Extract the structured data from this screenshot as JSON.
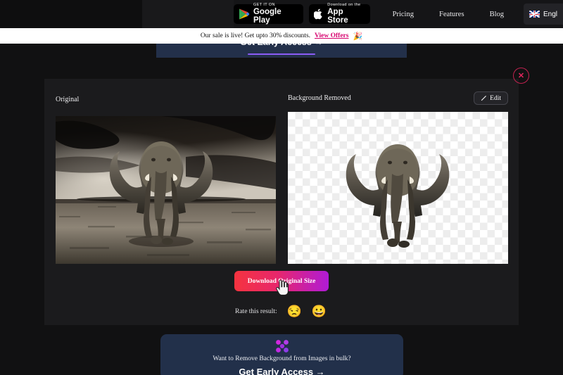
{
  "topnav": {
    "google_play": {
      "small": "GET IT ON",
      "big": "Google Play"
    },
    "app_store": {
      "small": "Download on the",
      "big": "App Store"
    },
    "links": [
      {
        "label": "Pricing"
      },
      {
        "label": "Features"
      },
      {
        "label": "Blog"
      }
    ],
    "language": {
      "label": "Engl",
      "flag": "uk-flag-icon"
    }
  },
  "salebar": {
    "text": "Our sale is live! Get upto 30% discounts.",
    "link": "View Offers",
    "emoji": "🎉"
  },
  "top_promo": {
    "cta": "Get Early Access →"
  },
  "close": {
    "label": "✕"
  },
  "result": {
    "original_label": "Original",
    "removed_label": "Background Removed",
    "edit_label": "Edit",
    "edit_icon": "pencil-icon",
    "original_image_alt": "Black and white photo of an elephant walking on dry plain under stormy sky",
    "removed_image_alt": "Cut-out elephant on transparency checkerboard"
  },
  "download": {
    "label": "Download Original Size"
  },
  "rate": {
    "label": "Rate this result:",
    "negative_emoji": "😒",
    "positive_emoji": "😀"
  },
  "bottom_promo": {
    "question": "Want to Remove Background from Images in bulk?",
    "cta": "Get Early Access →",
    "logo": "x-dots-logo-icon"
  },
  "colors": {
    "page_bg": "#111112",
    "card_bg": "#1b1b1d",
    "accent_gradient_start": "#f5333f",
    "accent_gradient_end": "#b01bd6",
    "promo_bg": "#22304a",
    "close_accent": "#e0255c",
    "offer_link": "#d6006e"
  }
}
